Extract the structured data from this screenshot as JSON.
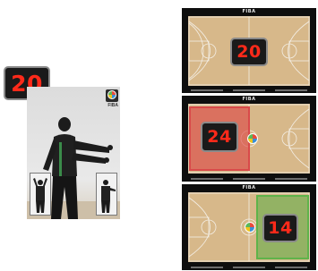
{
  "referee_view": {
    "shot_clock": "20",
    "logo_text": "FIBA"
  },
  "panels": [
    {
      "brand": "FIBA",
      "shot_clock": "20"
    },
    {
      "brand": "FIBA",
      "shot_clock": "24",
      "zone": "left",
      "zone_color": "#d94a4a"
    },
    {
      "brand": "FIBA",
      "shot_clock": "14",
      "zone": "right",
      "zone_color": "#5fb34a"
    }
  ],
  "colors": {
    "digit": "#ff2a1a",
    "clock_bg": "#1a1a1a",
    "court": "#d7b88a"
  }
}
